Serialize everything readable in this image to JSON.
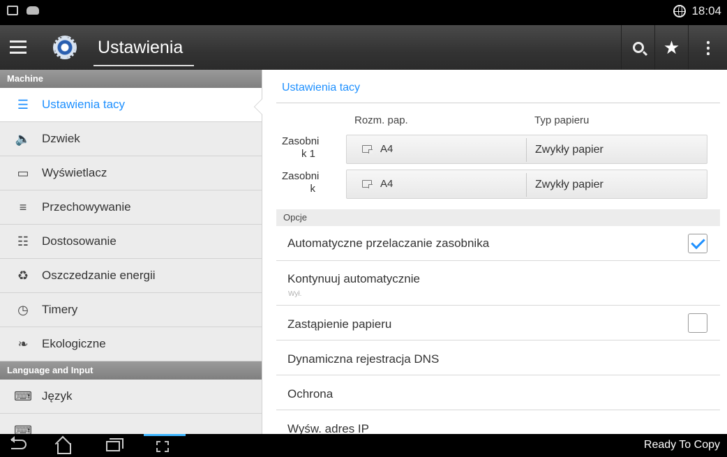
{
  "status_bar": {
    "time": "18:04"
  },
  "action_bar": {
    "title": "Ustawienia"
  },
  "sidebar": {
    "sections": [
      {
        "header": "Machine",
        "items": [
          {
            "label": "Ustawienia tacy",
            "icon": "tray-list-icon",
            "active": true
          },
          {
            "label": "Dzwiek",
            "icon": "speaker-icon"
          },
          {
            "label": "Wyświetlacz",
            "icon": "monitor-icon"
          },
          {
            "label": "Przechowywanie",
            "icon": "database-icon"
          },
          {
            "label": "Dostosowanie",
            "icon": "sliders-icon"
          },
          {
            "label": "Oszczedzanie energii",
            "icon": "recycle-icon"
          },
          {
            "label": "Timery",
            "icon": "stopwatch-icon"
          },
          {
            "label": "Ekologiczne",
            "icon": "leaf-icon"
          }
        ]
      },
      {
        "header": "Language and Input",
        "items": [
          {
            "label": "Język",
            "icon": "abc-keyboard-icon"
          }
        ]
      }
    ]
  },
  "main": {
    "title": "Ustawienia tacy",
    "columns": {
      "size": "Rozm. pap.",
      "type": "Typ papieru"
    },
    "trays": [
      {
        "label_line1": "Zasobni",
        "label_line2": "k 1",
        "size": "A4",
        "type": "Zwykły papier"
      },
      {
        "label_line1": "Zasobni",
        "label_line2": "k",
        "size": "A4",
        "type": "Zwykły papier"
      }
    ],
    "options_header": "Opcje",
    "options": [
      {
        "label": "Automatyczne przelaczanie zasobnika",
        "checked": true
      },
      {
        "label": "Kontynuuj automatycznie",
        "sub": "Wył."
      },
      {
        "label": "Zastąpienie papieru",
        "checked": false
      },
      {
        "label": "Dynamiczna rejestracja DNS"
      },
      {
        "label": "Ochrona"
      },
      {
        "label": "Wyśw. adres IP"
      }
    ]
  },
  "nav_bar": {
    "status": "Ready To Copy"
  },
  "colors": {
    "accent": "#1e90ff",
    "action_bar": "#3a3a3a",
    "sidebar_bg": "#ececec",
    "section_header": "#8c8c8c"
  }
}
